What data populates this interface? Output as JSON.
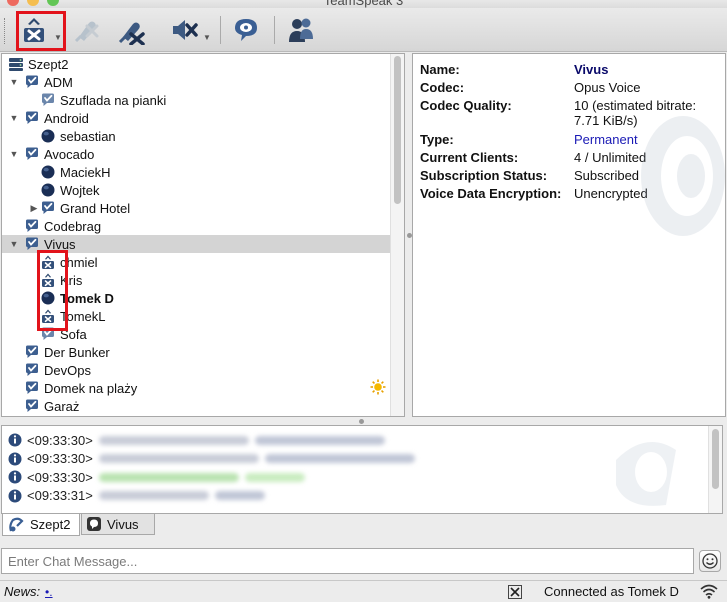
{
  "window": {
    "title": "TeamSpeak 3"
  },
  "toolbar": {
    "buttons": [
      {
        "id": "away",
        "icon": "away-status-icon",
        "has_menu": true
      },
      {
        "id": "mute-mic",
        "icon": "microphone-mute-icon",
        "has_menu": false
      },
      {
        "id": "mute-speakers",
        "icon": "speakers-mute-icon",
        "has_menu": false
      },
      {
        "id": "sound-toggle",
        "icon": "sound-mute-icon",
        "has_menu": true
      },
      {
        "id": "subscribe",
        "icon": "speech-bubble-icon",
        "has_menu": false
      },
      {
        "id": "contacts",
        "icon": "contacts-icon",
        "has_menu": false
      }
    ]
  },
  "tree": {
    "server": "Szept2",
    "rows": [
      {
        "type": "channel",
        "label": "ADM",
        "level": 1,
        "expanded": true
      },
      {
        "type": "subchannel",
        "label": "Szuflada na pianki",
        "level": 2
      },
      {
        "type": "channel",
        "label": "Android",
        "level": 1,
        "expanded": true
      },
      {
        "type": "client",
        "label": "sebastian",
        "level": 2
      },
      {
        "type": "channel",
        "label": "Avocado",
        "level": 1,
        "expanded": true
      },
      {
        "type": "client",
        "label": "MaciekH",
        "level": 2
      },
      {
        "type": "client",
        "label": "Wojtek",
        "level": 2
      },
      {
        "type": "channel",
        "label": "Grand Hotel",
        "level": 2,
        "expanded": false
      },
      {
        "type": "channel",
        "label": "Codebrag",
        "level": 1
      },
      {
        "type": "channel",
        "label": "Vivus",
        "level": 1,
        "expanded": true,
        "selected": true
      },
      {
        "type": "client-away",
        "label": "chmiel",
        "level": 2
      },
      {
        "type": "client-away",
        "label": "Kris",
        "level": 2
      },
      {
        "type": "client-self",
        "label": "Tomek D",
        "level": 2
      },
      {
        "type": "client-away",
        "label": "TomekL",
        "level": 2
      },
      {
        "type": "subchannel",
        "label": "Sofa",
        "level": 2
      },
      {
        "type": "channel",
        "label": "Der Bunker",
        "level": 1
      },
      {
        "type": "channel",
        "label": "DevOps",
        "level": 1
      },
      {
        "type": "channel",
        "label": "Domek na plaży",
        "level": 1,
        "badge": "sun-icon"
      },
      {
        "type": "channel",
        "label": "Garaż",
        "level": 1
      }
    ]
  },
  "info": {
    "rows": [
      {
        "key": "Name:",
        "value": "Vivus",
        "style": "bold"
      },
      {
        "key": "Codec:",
        "value": "Opus Voice",
        "style": ""
      },
      {
        "key": "Codec Quality:",
        "value": "10 (estimated bitrate: 7.71 KiB/s)",
        "style": ""
      },
      {
        "key": "Type:",
        "value": "Permanent",
        "style": "blue"
      },
      {
        "key": "Current Clients:",
        "value": "4 / Unlimited",
        "style": ""
      },
      {
        "key": "Subscription Status:",
        "value": "Subscribed",
        "style": ""
      },
      {
        "key": "Voice Data Encryption:",
        "value": "Unencrypted",
        "style": ""
      }
    ]
  },
  "log": {
    "rows": [
      {
        "time": "<09:33:30>"
      },
      {
        "time": "<09:33:30>"
      },
      {
        "time": "<09:33:30>"
      },
      {
        "time": "<09:33:31>"
      }
    ]
  },
  "tabs": [
    {
      "label": "Szept2",
      "icon": "server-tab-icon",
      "active": true
    },
    {
      "label": "Vivus",
      "icon": "channel-tab-icon",
      "active": false
    }
  ],
  "chat": {
    "placeholder": "Enter Chat Message..."
  },
  "status": {
    "news_label": "News:",
    "news_link": "•.",
    "connection": "Connected as Tomek D"
  },
  "colors": {
    "highlight_red": "#e2131b",
    "link_blue": "#1a1ab5",
    "selection": "#d4d4d4"
  }
}
